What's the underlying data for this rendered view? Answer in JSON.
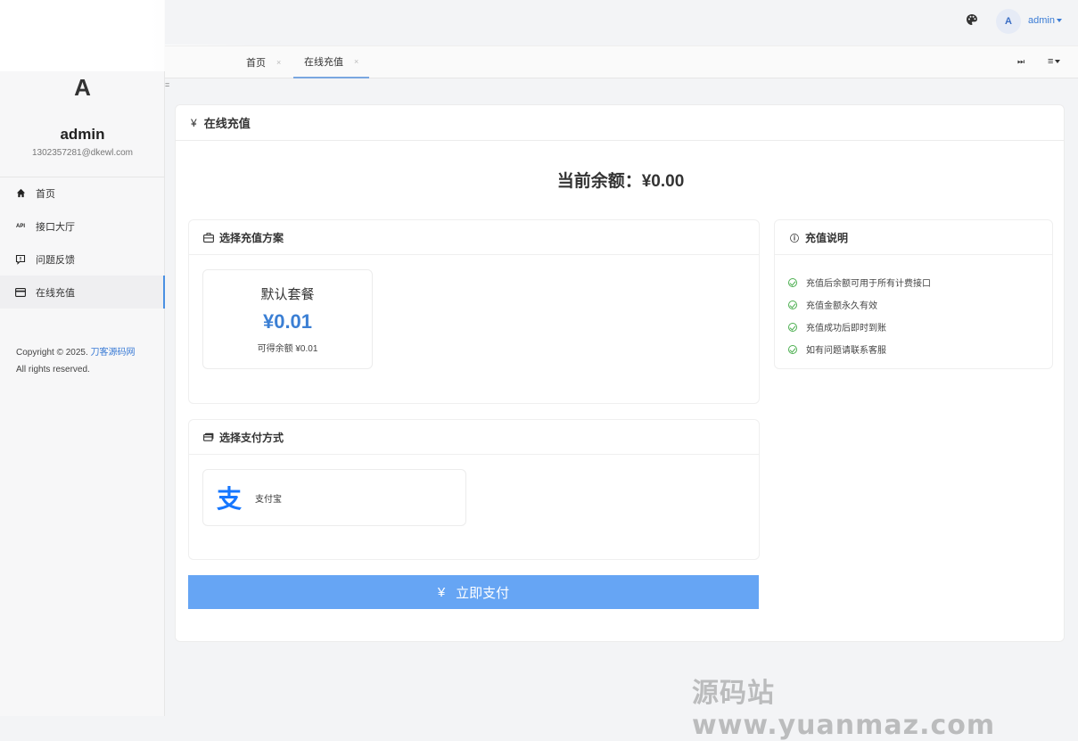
{
  "header": {
    "user_avatar_letter": "A",
    "user_name": "admin"
  },
  "sidebar": {
    "avatar_letter": "A",
    "username": "admin",
    "email": "1302357281@dkewl.com",
    "items": [
      {
        "label": "首页",
        "icon": "home-icon"
      },
      {
        "label": "接口大厅",
        "icon": "api-icon"
      },
      {
        "label": "问题反馈",
        "icon": "feedback-icon"
      },
      {
        "label": "在线充值",
        "icon": "card-icon",
        "active": true
      }
    ],
    "copyright_prefix": "Copyright © 2025.",
    "copyright_link": "刀客源码网",
    "copyright_rights": "All rights reserved."
  },
  "tabs": [
    {
      "label": "首页",
      "close": "×"
    },
    {
      "label": "在线充值",
      "close": "×",
      "active": true
    }
  ],
  "tabs_right": {
    "skip_icon": "⏭",
    "menu_icon": "≡"
  },
  "collapse_glyph": "=",
  "main": {
    "title_icon": "¥",
    "title": "在线充值",
    "balance_label": "当前余额：¥0.00",
    "plans_panel": {
      "title": "选择充值方案",
      "plans": [
        {
          "name": "默认套餐",
          "price": "¥0.01",
          "sub": "可得余额 ¥0.01"
        }
      ]
    },
    "pay_panel": {
      "title": "选择支付方式",
      "methods": [
        {
          "label": "支付宝",
          "icon": "alipay-icon"
        }
      ]
    },
    "notes_panel": {
      "title_icon": "ⓘ",
      "title": "充值说明",
      "items": [
        "充值后余额可用于所有计费接口",
        "充值金额永久有效",
        "充值成功后即时到账",
        "如有问题请联系客服"
      ]
    },
    "pay_button": {
      "icon": "¥",
      "label": "立即支付"
    }
  },
  "watermark": "源码站www.yuanmaz.com",
  "colors": {
    "accent": "#3b7fd4",
    "button": "#66a5f4",
    "success": "#4caf50"
  }
}
